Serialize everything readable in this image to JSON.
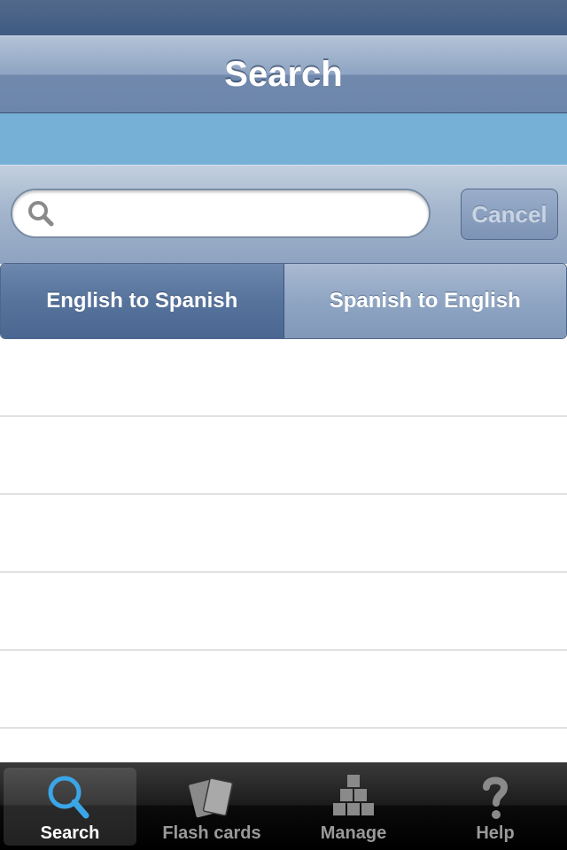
{
  "nav": {
    "title": "Search"
  },
  "search": {
    "placeholder": "",
    "value": "",
    "cancel_label": "Cancel"
  },
  "segments": [
    {
      "label": "English to Spanish",
      "selected": true
    },
    {
      "label": "Spanish to English",
      "selected": false
    }
  ],
  "list": {
    "rows": 6
  },
  "tabs": [
    {
      "label": "Search",
      "icon": "search-icon",
      "active": true
    },
    {
      "label": "Flash cards",
      "icon": "flash-cards-icon",
      "active": false
    },
    {
      "label": "Manage",
      "icon": "boxes-stack-icon",
      "active": false
    },
    {
      "label": "Help",
      "icon": "question-mark-icon",
      "active": false
    }
  ],
  "colors": {
    "nav_bar": "#8ea4c2",
    "accent_strip": "#76b0d7",
    "active_tab_icon": "#3aa6e8",
    "tab_bar": "#1c1c1c"
  }
}
